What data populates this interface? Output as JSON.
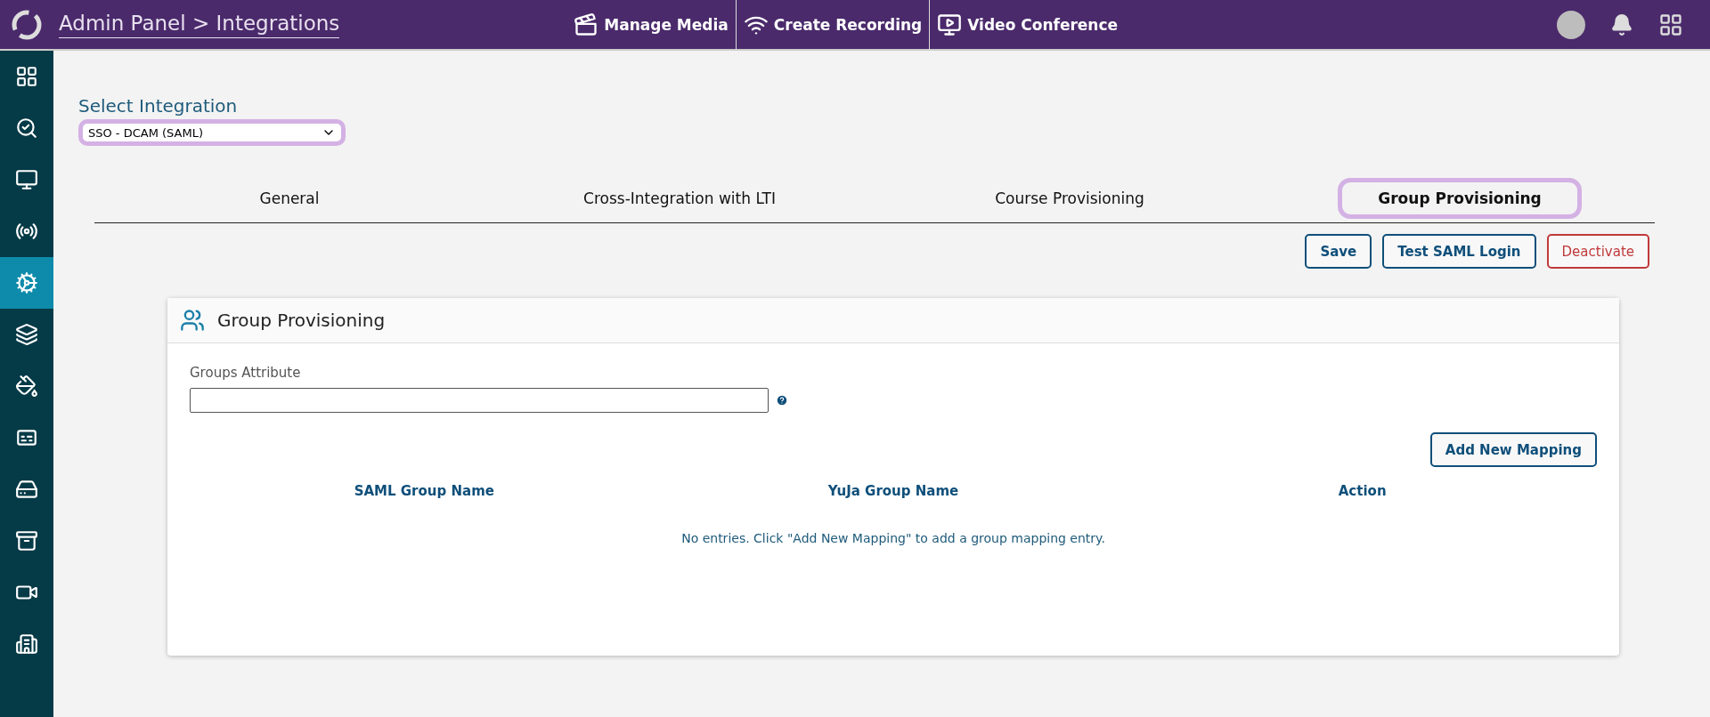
{
  "header": {
    "breadcrumb": "Admin Panel > Integrations",
    "actions": [
      {
        "label": "Manage Media",
        "kind": "media"
      },
      {
        "label": "Create Recording",
        "kind": "record"
      },
      {
        "label": "Video Conference",
        "kind": "conference"
      }
    ]
  },
  "sidebar": {
    "items": [
      {
        "kind": "dashboard",
        "selected": false
      },
      {
        "kind": "search",
        "selected": false
      },
      {
        "kind": "monitor",
        "selected": false
      },
      {
        "kind": "broadcast",
        "selected": false
      },
      {
        "kind": "gears",
        "selected": true
      },
      {
        "kind": "layers",
        "selected": false
      },
      {
        "kind": "paint",
        "selected": false
      },
      {
        "kind": "captions",
        "selected": false
      },
      {
        "kind": "drive",
        "selected": false
      },
      {
        "kind": "archive",
        "selected": false
      },
      {
        "kind": "camera",
        "selected": false
      },
      {
        "kind": "building",
        "selected": false
      }
    ]
  },
  "integration": {
    "label": "Select Integration",
    "value": "SSO - DCAM (SAML)"
  },
  "tabs": [
    {
      "label": "General",
      "selected": false
    },
    {
      "label": "Cross-Integration with LTI",
      "selected": false
    },
    {
      "label": "Course Provisioning",
      "selected": false
    },
    {
      "label": "Group Provisioning",
      "selected": true
    }
  ],
  "buttons": [
    {
      "label": "Save",
      "kind": "primary"
    },
    {
      "label": "Test SAML Login",
      "kind": "primary"
    },
    {
      "label": "Deactivate",
      "kind": "danger"
    }
  ],
  "card": {
    "title": "Group Provisioning",
    "field_label": "Groups Attribute",
    "add_button": "Add New Mapping",
    "table": {
      "columns": [
        "SAML Group Name",
        "YuJa Group Name",
        "Action"
      ],
      "empty_message": "No entries. Click \"Add New Mapping\" to add a group mapping entry."
    }
  }
}
